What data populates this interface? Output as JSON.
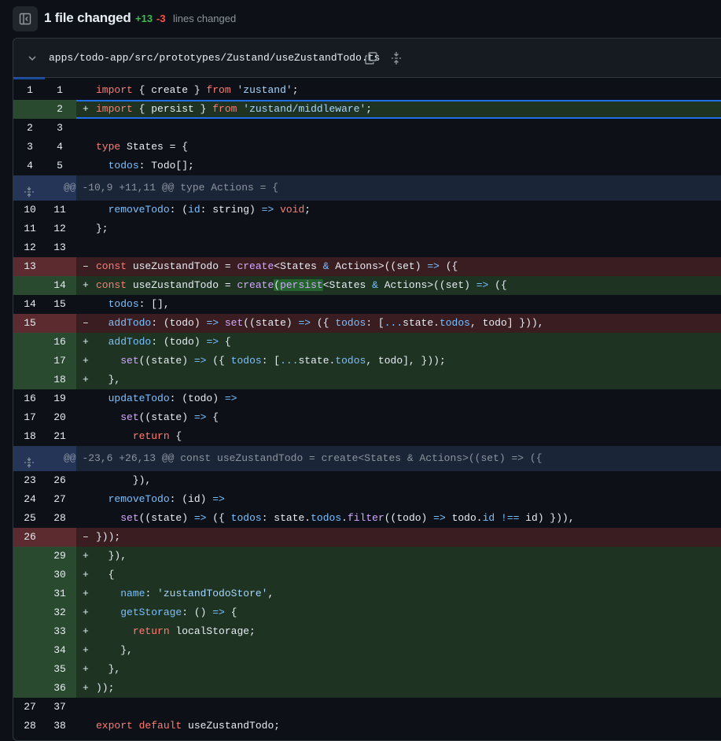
{
  "summary": {
    "title": "1 file changed",
    "additions": "+13",
    "deletions": "-3",
    "lines_changed_label": "lines changed"
  },
  "file": {
    "path": "apps/todo-app/src/prototypes/Zustand/useZustandTodo.ts"
  },
  "colors": {
    "add_bg": "#1f3323",
    "del_bg": "#3a1d21",
    "hunk_bg": "#1b2538",
    "accent": "#1f6feb"
  },
  "rows": [
    {
      "type": "ctx",
      "old": "1",
      "new": "1",
      "sign": " ",
      "code": "import { create } from 'zustand';"
    },
    {
      "type": "add",
      "old": "",
      "new": "2",
      "sign": "+",
      "code": "import { persist } from 'zustand/middleware';"
    },
    {
      "type": "ctx",
      "old": "2",
      "new": "3",
      "sign": " ",
      "code": ""
    },
    {
      "type": "ctx",
      "old": "3",
      "new": "4",
      "sign": " ",
      "code": "type States = {"
    },
    {
      "type": "ctx",
      "old": "4",
      "new": "5",
      "sign": " ",
      "code": "  todos: Todo[];"
    },
    {
      "type": "hunk",
      "code": "@@ -10,9 +11,11 @@ type Actions = {"
    },
    {
      "type": "ctx",
      "old": "10",
      "new": "11",
      "sign": " ",
      "code": "  removeTodo: (id: string) => void;"
    },
    {
      "type": "ctx",
      "old": "11",
      "new": "12",
      "sign": " ",
      "code": "};"
    },
    {
      "type": "ctx",
      "old": "12",
      "new": "13",
      "sign": " ",
      "code": ""
    },
    {
      "type": "del",
      "old": "13",
      "new": "",
      "sign": "-",
      "code": "const useZustandTodo = create<States & Actions>((set) => ({"
    },
    {
      "type": "add",
      "old": "",
      "new": "14",
      "sign": "+",
      "code": "const useZustandTodo = create(persist<States & Actions>((set) => ({"
    },
    {
      "type": "ctx",
      "old": "14",
      "new": "15",
      "sign": " ",
      "code": "  todos: [],"
    },
    {
      "type": "del",
      "old": "15",
      "new": "",
      "sign": "-",
      "code": "  addTodo: (todo) => set((state) => ({ todos: [...state.todos, todo] })),"
    },
    {
      "type": "add",
      "old": "",
      "new": "16",
      "sign": "+",
      "code": "  addTodo: (todo) => {"
    },
    {
      "type": "add",
      "old": "",
      "new": "17",
      "sign": "+",
      "code": "    set((state) => ({ todos: [...state.todos, todo], }));"
    },
    {
      "type": "add",
      "old": "",
      "new": "18",
      "sign": "+",
      "code": "  },"
    },
    {
      "type": "ctx",
      "old": "16",
      "new": "19",
      "sign": " ",
      "code": "  updateTodo: (todo) =>"
    },
    {
      "type": "ctx",
      "old": "17",
      "new": "20",
      "sign": " ",
      "code": "    set((state) => {"
    },
    {
      "type": "ctx",
      "old": "18",
      "new": "21",
      "sign": " ",
      "code": "      return {"
    },
    {
      "type": "hunk",
      "code": "@@ -23,6 +26,13 @@ const useZustandTodo = create<States & Actions>((set) => ({"
    },
    {
      "type": "ctx",
      "old": "23",
      "new": "26",
      "sign": " ",
      "code": "      }),"
    },
    {
      "type": "ctx",
      "old": "24",
      "new": "27",
      "sign": " ",
      "code": "  removeTodo: (id) =>"
    },
    {
      "type": "ctx",
      "old": "25",
      "new": "28",
      "sign": " ",
      "code": "    set((state) => ({ todos: state.todos.filter((todo) => todo.id !== id) })),"
    },
    {
      "type": "del",
      "old": "26",
      "new": "",
      "sign": "-",
      "code": "}));"
    },
    {
      "type": "add",
      "old": "",
      "new": "29",
      "sign": "+",
      "code": "  }),"
    },
    {
      "type": "add",
      "old": "",
      "new": "30",
      "sign": "+",
      "code": "  {"
    },
    {
      "type": "add",
      "old": "",
      "new": "31",
      "sign": "+",
      "code": "    name: 'zustandTodoStore',"
    },
    {
      "type": "add",
      "old": "",
      "new": "32",
      "sign": "+",
      "code": "    getStorage: () => {"
    },
    {
      "type": "add",
      "old": "",
      "new": "33",
      "sign": "+",
      "code": "      return localStorage;"
    },
    {
      "type": "add",
      "old": "",
      "new": "34",
      "sign": "+",
      "code": "    },"
    },
    {
      "type": "add",
      "old": "",
      "new": "35",
      "sign": "+",
      "code": "  },"
    },
    {
      "type": "add",
      "old": "",
      "new": "36",
      "sign": "+",
      "code": "));"
    },
    {
      "type": "ctx",
      "old": "27",
      "new": "37",
      "sign": " ",
      "code": ""
    },
    {
      "type": "ctx",
      "old": "28",
      "new": "38",
      "sign": " ",
      "code": "export default useZustandTodo;"
    }
  ]
}
